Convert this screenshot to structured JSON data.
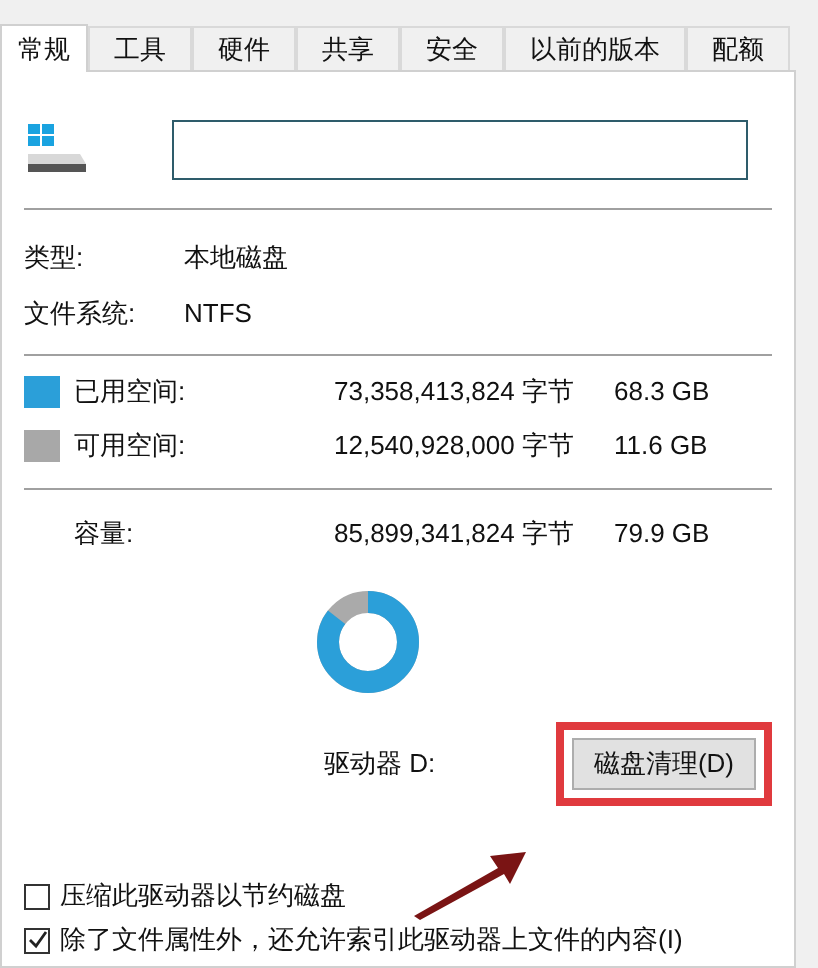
{
  "tabs": [
    {
      "label": "常规",
      "selected": true
    },
    {
      "label": "工具",
      "selected": false
    },
    {
      "label": "硬件",
      "selected": false
    },
    {
      "label": "共享",
      "selected": false
    },
    {
      "label": "安全",
      "selected": false
    },
    {
      "label": "以前的版本",
      "selected": false
    },
    {
      "label": "配额",
      "selected": false
    }
  ],
  "info": [
    {
      "label": "类型:",
      "value": "本地磁盘"
    },
    {
      "label": "文件系统:",
      "value": "NTFS"
    }
  ],
  "space": [
    {
      "label": "已用空间:",
      "bytes": "73,358,413,824 字节",
      "size": "68.3 GB",
      "color": "#2b9fd9"
    },
    {
      "label": "可用空间:",
      "bytes": "12,540,928,000 字节",
      "size": "11.6 GB",
      "color": "#a8a8a8"
    }
  ],
  "capacity": {
    "label": "容量:",
    "bytes": "85,899,341,824 字节",
    "size": "79.9 GB"
  },
  "usage_ring": {
    "level": 0.855
  },
  "drive_label": "驱动器 D:",
  "cleanup_button": {
    "label": "磁盘清理(D)",
    "highlighted": true
  },
  "options": [
    {
      "label": "压缩此驱动器以节约磁盘",
      "checked": false
    },
    {
      "label": "除了文件属性外，还允许索引此驱动器上文件的内容(I)",
      "checked": true
    }
  ]
}
